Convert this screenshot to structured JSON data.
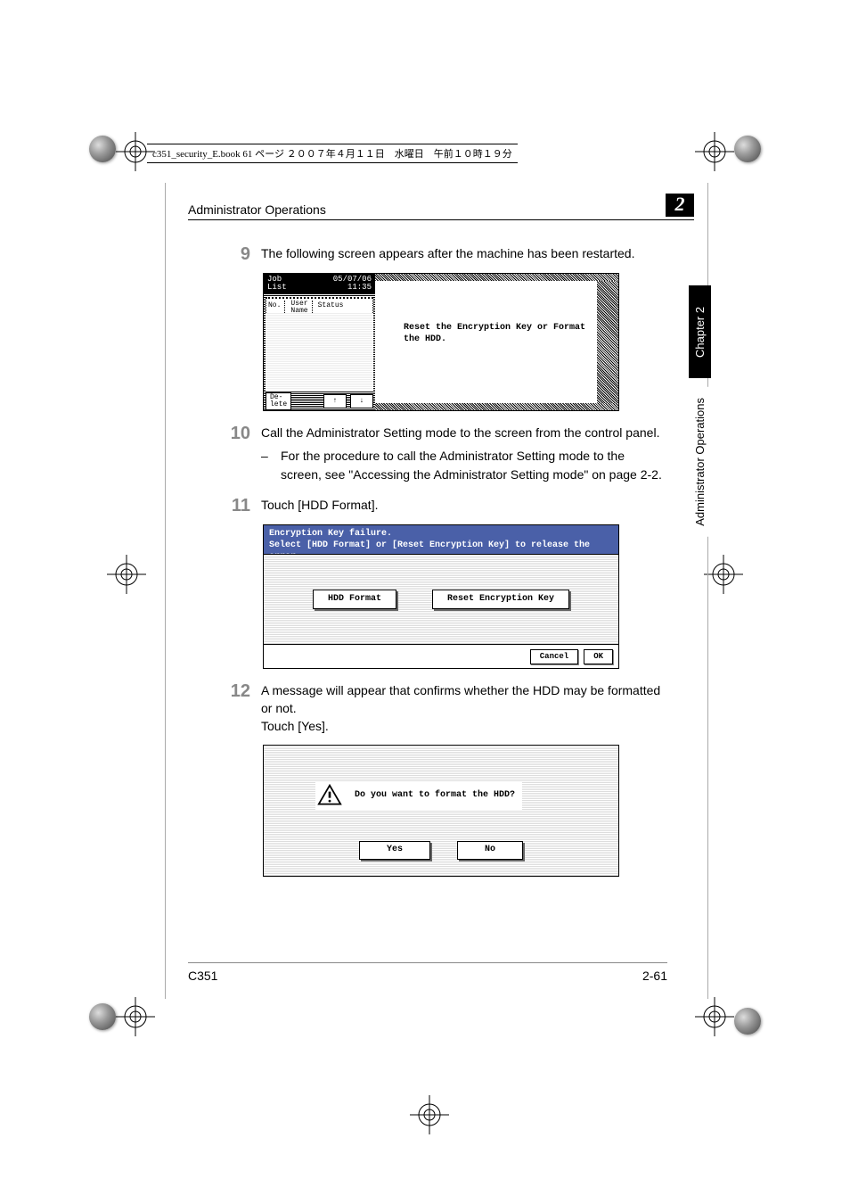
{
  "header": {
    "meta_line": "c351_security_E.book  61 ページ  ２００７年４月１１日　水曜日　午前１０時１９分"
  },
  "running_head": {
    "title": "Administrator Operations",
    "chapter_number": "2"
  },
  "side": {
    "chapter_tab": "Chapter 2",
    "section_tab": "Administrator Operations"
  },
  "steps": {
    "s9": {
      "num": "9",
      "text": "The following screen appears after the machine has been restarted."
    },
    "s10": {
      "num": "10",
      "text": "Call the Administrator Setting mode to the screen from the control panel.",
      "bullet": "For the procedure to call the Administrator Setting mode to the screen, see \"Accessing the Administrator Setting mode\" on page 2-2."
    },
    "s11": {
      "num": "11",
      "text": "Touch [HDD Format]."
    },
    "s12": {
      "num": "12",
      "text": "A message will appear that confirms whether the HDD may be formatted or not.",
      "text2": "Touch [Yes]."
    }
  },
  "shot1": {
    "job_label": "Job\nList",
    "timestamp": "05/07/06\n11:35",
    "col_no": "No.",
    "col_user": "User\nName",
    "col_status": "Status",
    "delete_btn": "De-\nlete",
    "arrow_up": "↑",
    "arrow_down": "↓",
    "message": "Reset the Encryption Key or Format\nthe HDD."
  },
  "shot2": {
    "line1": "Encryption Key failure.",
    "line2": "Select [HDD Format] or [Reset Encryption Key] to release the error.",
    "opt1": "HDD Format",
    "opt2": "Reset Encryption Key",
    "cancel": "Cancel",
    "ok": "OK"
  },
  "shot3": {
    "message": "Do you want to format the HDD?",
    "yes": "Yes",
    "no": "No"
  },
  "footer": {
    "model": "C351",
    "page": "2-61"
  }
}
